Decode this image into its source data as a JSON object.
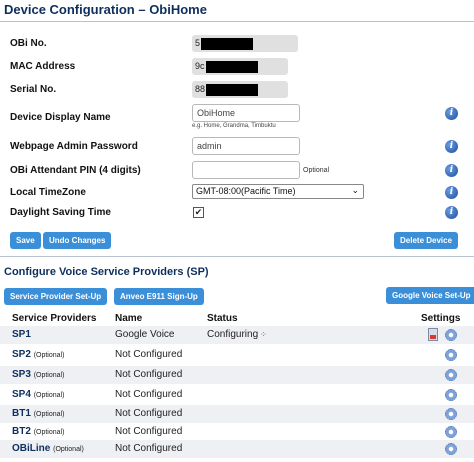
{
  "page": {
    "title": "Device Configuration – ObiHome"
  },
  "config": {
    "obi_no": {
      "label": "OBi No.",
      "value": "5"
    },
    "mac_address": {
      "label": "MAC Address",
      "value": "9c"
    },
    "serial_no": {
      "label": "Serial No.",
      "value": "88"
    },
    "device_display_name": {
      "label": "Device Display Name",
      "value": "ObiHome",
      "hint": "e.g. Home, Grandma, Timbuktu"
    },
    "admin_password": {
      "label": "Webpage Admin Password",
      "value": "admin"
    },
    "attendant_pin": {
      "label": "OBi Attendant PIN (4 digits)",
      "value": "",
      "note": "Optional"
    },
    "timezone": {
      "label": "Local TimeZone",
      "selected": "GMT-08:00(Pacific Time)"
    },
    "daylight_saving": {
      "label": "Daylight Saving Time",
      "checked": true,
      "mark": "✔"
    }
  },
  "buttons": {
    "save": "Save",
    "undo": "Undo Changes",
    "delete": "Delete Device",
    "sp_setup": "Service Provider Set-Up",
    "anveo": "Anveo E911 Sign-Up",
    "gv_setup": "Google Voice Set-Up"
  },
  "voice": {
    "section_title": "Configure Voice Service Providers (SP)",
    "headers": {
      "providers": "Service Providers",
      "name": "Name",
      "status": "Status",
      "settings": "Settings"
    },
    "rows": [
      {
        "sp": "SP1",
        "optional": "",
        "name": "Google Voice",
        "status": "Configuring",
        "spinner": "⁘"
      },
      {
        "sp": "SP2",
        "optional": "(Optional)",
        "name": "Not Configured",
        "status": ""
      },
      {
        "sp": "SP3",
        "optional": "(Optional)",
        "name": "Not Configured",
        "status": ""
      },
      {
        "sp": "SP4",
        "optional": "(Optional)",
        "name": "Not Configured",
        "status": ""
      },
      {
        "sp": "BT1",
        "optional": "(Optional)",
        "name": "Not Configured",
        "status": ""
      },
      {
        "sp": "BT2",
        "optional": "(Optional)",
        "name": "Not Configured",
        "status": ""
      },
      {
        "sp": "OBiLine",
        "optional": "(Optional)",
        "name": "Not Configured",
        "status": ""
      }
    ]
  },
  "icons": {
    "info": "info-icon",
    "gear": "gear-icon",
    "document": "document-icon",
    "info_glyph": "i"
  },
  "colors": {
    "title": "#0e2f5e",
    "button": "#3a8fd8",
    "row_shade": "#eef0f4"
  }
}
